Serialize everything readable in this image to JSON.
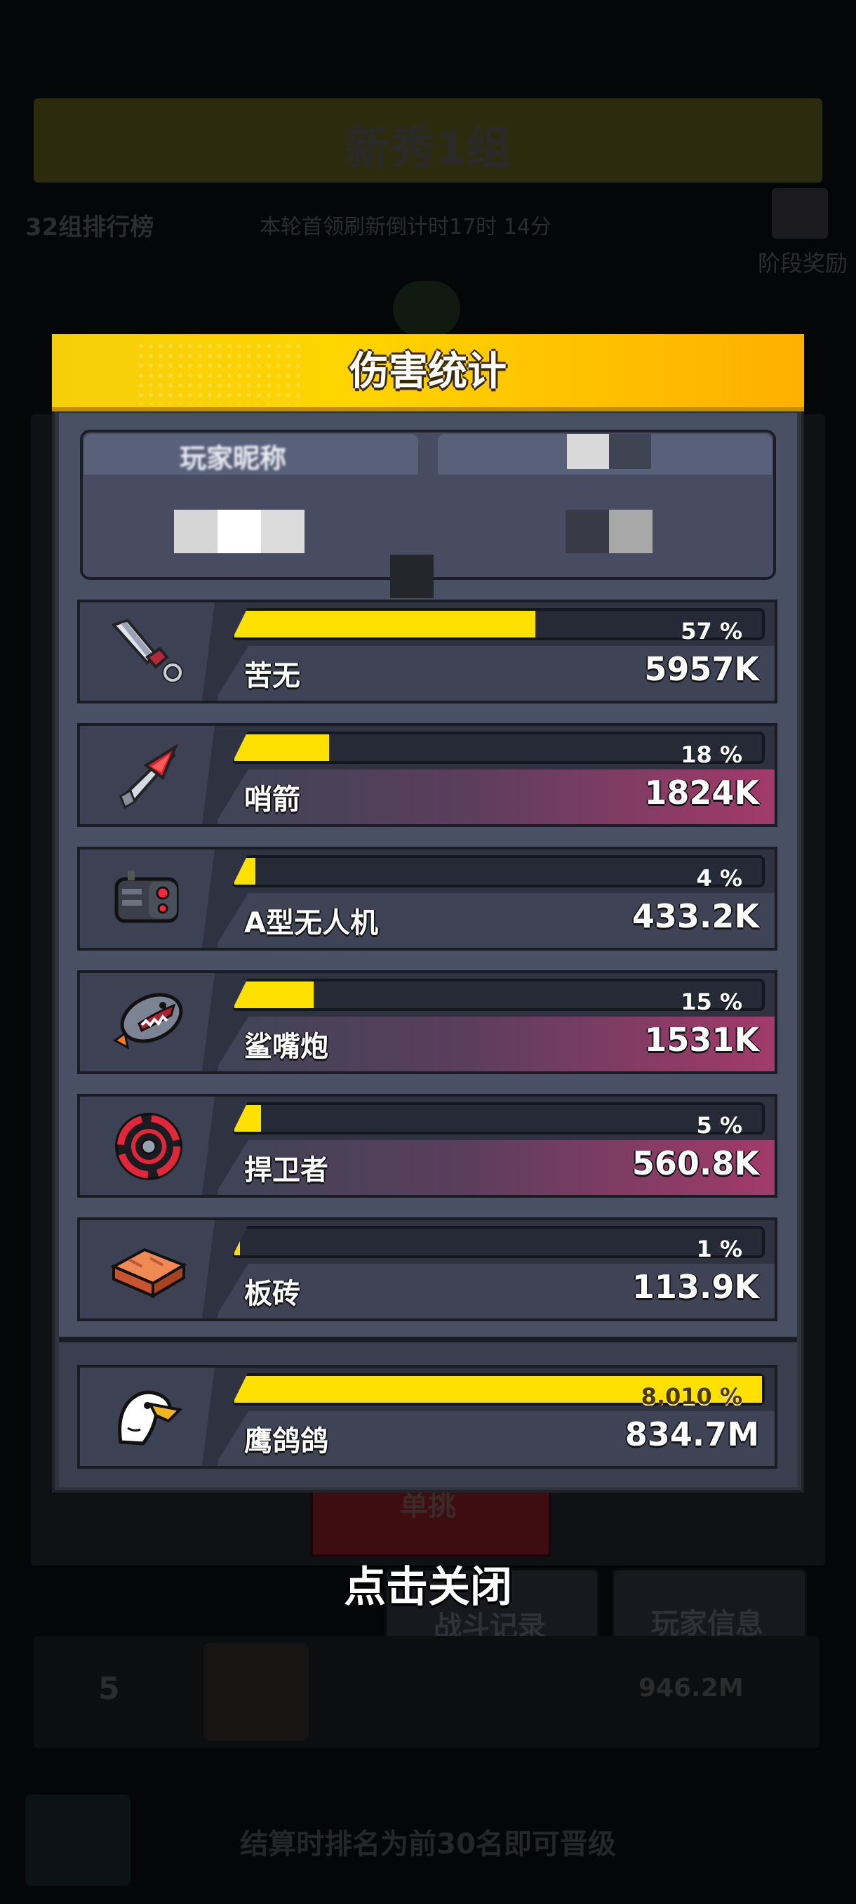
{
  "background": {
    "group_title": "新秀1组",
    "rank_label": "32组排行榜",
    "refresh_timer": "本轮首领刷新倒计时17时 14分",
    "stage_reward": "阶段奖励",
    "red_button": "单挑",
    "battle_log_button": "战斗记录",
    "player_info_button": "玩家信息",
    "row_rank": "5",
    "row_score": "946.2M",
    "footer_hint": "结算时排名为前30名即可晋级"
  },
  "dialog": {
    "title": "伤害统计",
    "player_nick_label": "玩家昵称",
    "close_hint": "点击关闭"
  },
  "stats": [
    {
      "name": "苦无",
      "percent": "57 %",
      "value": "5957K",
      "fill": 0.57,
      "icon": "kunai-icon",
      "band": "plain"
    },
    {
      "name": "哨箭",
      "percent": "18 %",
      "value": "1824K",
      "fill": 0.18,
      "icon": "whistle-arrow-icon",
      "band": "pink"
    },
    {
      "name": "A型无人机",
      "percent": "4 %",
      "value": "433.2K",
      "fill": 0.04,
      "icon": "drone-a-icon",
      "band": "plain"
    },
    {
      "name": "鲨嘴炮",
      "percent": "15 %",
      "value": "1531K",
      "fill": 0.15,
      "icon": "shark-cannon-icon",
      "band": "pink"
    },
    {
      "name": "捍卫者",
      "percent": "5 %",
      "value": "560.8K",
      "fill": 0.05,
      "icon": "guardian-icon",
      "band": "pink"
    },
    {
      "name": "板砖",
      "percent": "1 %",
      "value": "113.9K",
      "fill": 0.01,
      "icon": "brick-icon",
      "band": "plain"
    }
  ],
  "pet": {
    "name": "鹰鸽鸽",
    "percent": "8,010 %",
    "value": "834.7M",
    "fill": 1.0,
    "icon": "eagle-pet-icon"
  },
  "colors": {
    "accent": "#ffe100",
    "header": "#ffd400",
    "panel": "#4a5063"
  }
}
